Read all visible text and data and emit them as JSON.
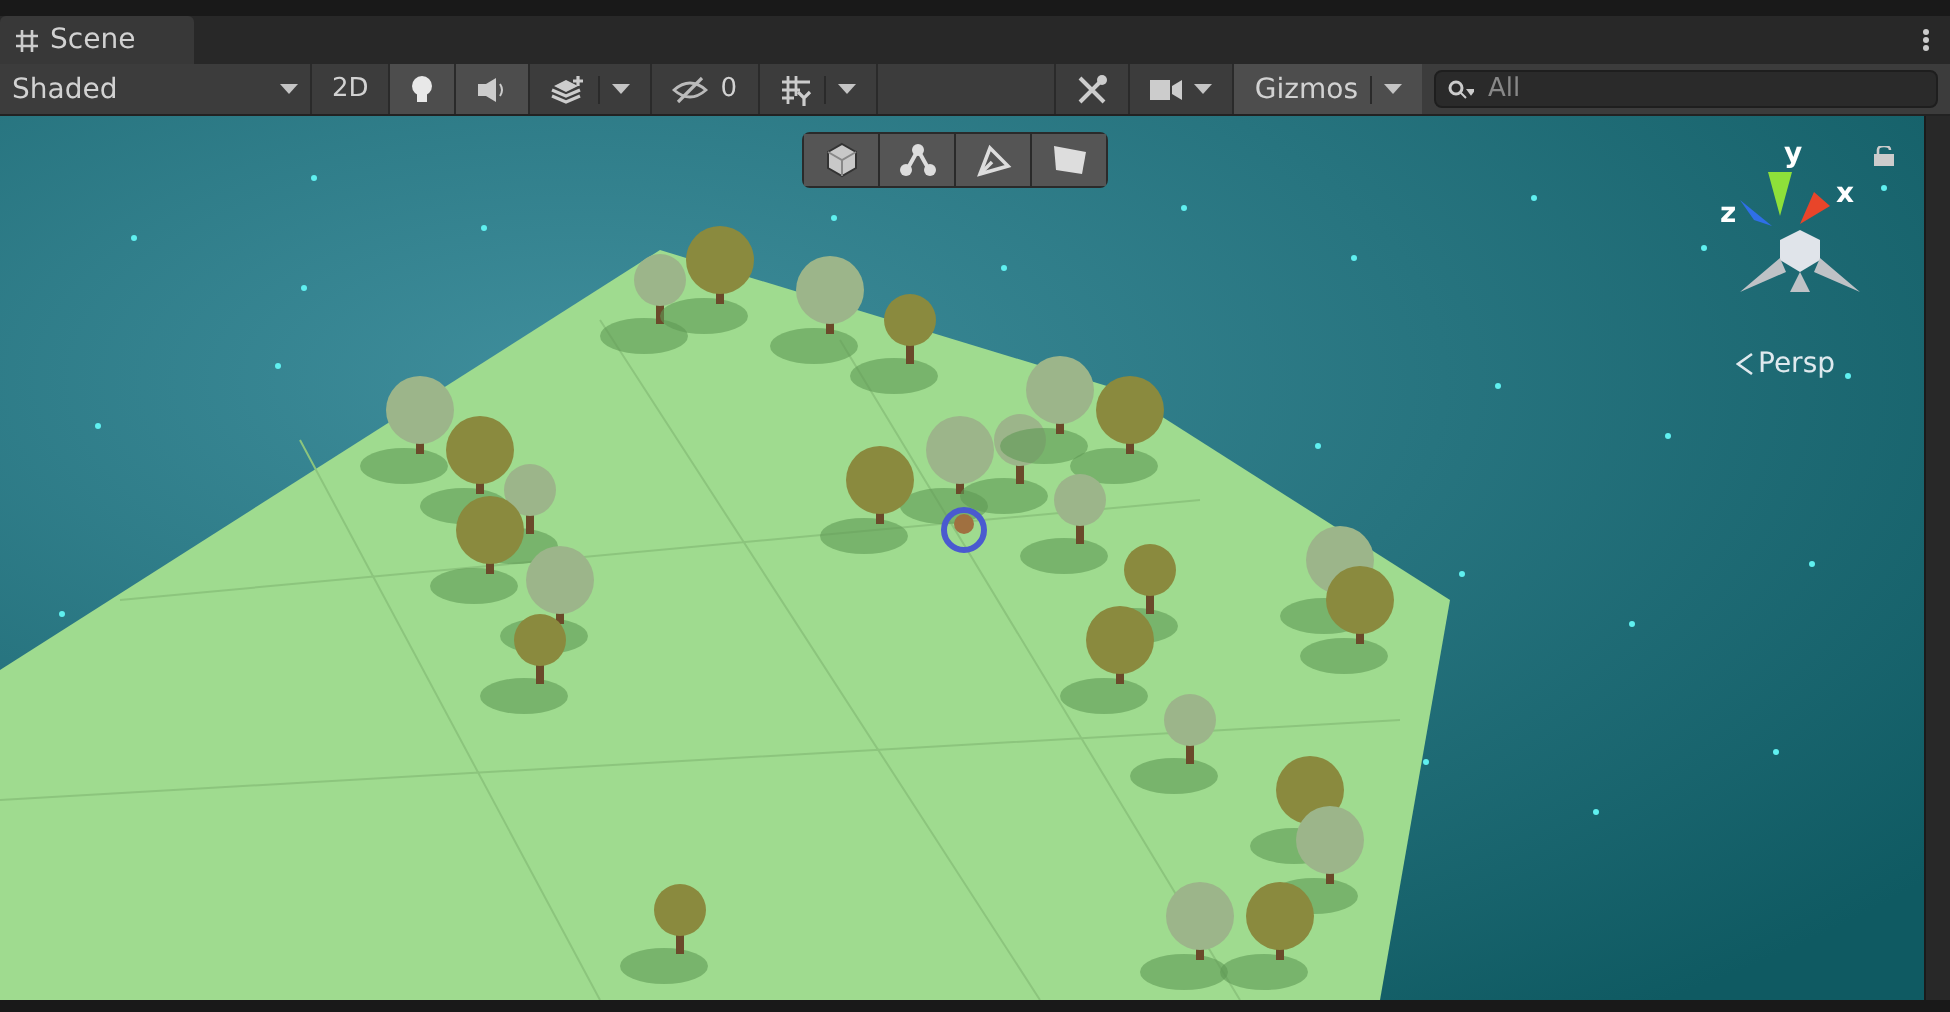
{
  "tab": {
    "label": "Scene",
    "selected": true
  },
  "toolbar": {
    "shading_mode": "Shaded",
    "items": [
      {
        "kind": "text",
        "label": "2D",
        "on": false
      },
      {
        "kind": "light",
        "on": true
      },
      {
        "kind": "audio",
        "on": true
      },
      {
        "kind": "effects",
        "on": false
      },
      {
        "kind": "visibility",
        "label": "0",
        "on": false
      },
      {
        "kind": "grid",
        "on": false
      }
    ],
    "right_items": [
      {
        "kind": "tools"
      },
      {
        "kind": "camera"
      }
    ],
    "gizmos": {
      "label": "Gizmos",
      "on": true
    },
    "search": {
      "placeholder": "All"
    }
  },
  "overlay_tools": [
    {
      "kind": "cube"
    },
    {
      "kind": "nodes"
    },
    {
      "kind": "pen"
    },
    {
      "kind": "plane"
    }
  ],
  "orientation_gizmo": {
    "axes": [
      {
        "label": "y",
        "color": "#8ee03a"
      },
      {
        "label": "x",
        "color": "#e8452a"
      },
      {
        "label": "z",
        "color": "#2f6fe8"
      }
    ],
    "projection": "Persp"
  }
}
